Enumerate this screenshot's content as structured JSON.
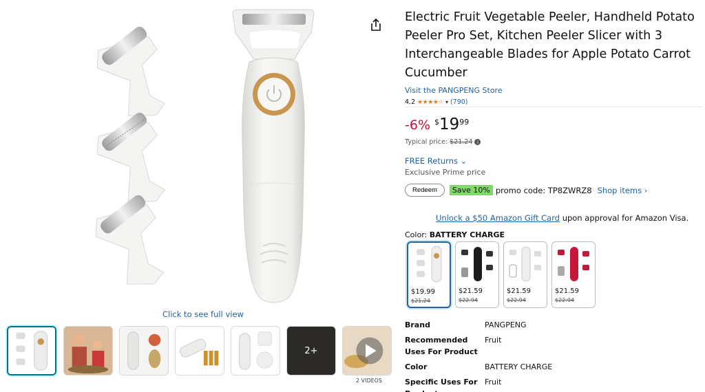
{
  "gallery": {
    "full_view_label": "Click to see full view",
    "more_label": "2+",
    "videos_label": "2 VIDEOS",
    "share_icon": "share-icon"
  },
  "product": {
    "title": "Electric Fruit Vegetable Peeler, Handheld Potato Peeler Pro Set, Kitchen Peeler Slicer with 3 Interchangeable Blades for Apple Potato Carrot Cucumber",
    "store_link": "Visit the PANGPENG Store",
    "rating_value": "4.2",
    "rating_stars": 4.2,
    "rating_stars_text": "★★★★☆",
    "review_count": "(790)"
  },
  "pricing": {
    "discount": "-6%",
    "currency": "$",
    "whole": "19",
    "fraction": "99",
    "typical_label": "Typical price:",
    "typical_price": "$21.24",
    "returns": "FREE Returns",
    "prime_note": "Exclusive Prime price"
  },
  "promo": {
    "redeem_label": "Redeem",
    "save_label": "Save 10%",
    "code_text": "promo code: TP8ZWRZ8",
    "shop_items": "Shop items ›"
  },
  "giftcard": {
    "link": "Unlock a $50 Amazon Gift Card",
    "rest": " upon approval for Amazon Visa."
  },
  "color": {
    "label": "Color: ",
    "selected": "BATTERY CHARGE",
    "options": [
      {
        "price": "$19.99",
        "original": "$21.24",
        "variant": "white"
      },
      {
        "price": "$21.59",
        "original": "$22.94",
        "variant": "black"
      },
      {
        "price": "$21.59",
        "original": "$22.94",
        "variant": "white-set"
      },
      {
        "price": "$21.59",
        "original": "$22.94",
        "variant": "red"
      }
    ]
  },
  "specs": [
    {
      "key": "Brand",
      "value": "PANGPENG"
    },
    {
      "key": "Recommended Uses For Product",
      "value": "Fruit"
    },
    {
      "key": "Color",
      "value": "BATTERY CHARGE"
    },
    {
      "key": "Specific Uses For Product",
      "value": "Fruit"
    }
  ],
  "colors": {
    "link": "#2162a1",
    "discount": "#cc0c39",
    "star": "#de7921",
    "save_badge": "#7fda69",
    "selected_border": "#2162a1"
  }
}
